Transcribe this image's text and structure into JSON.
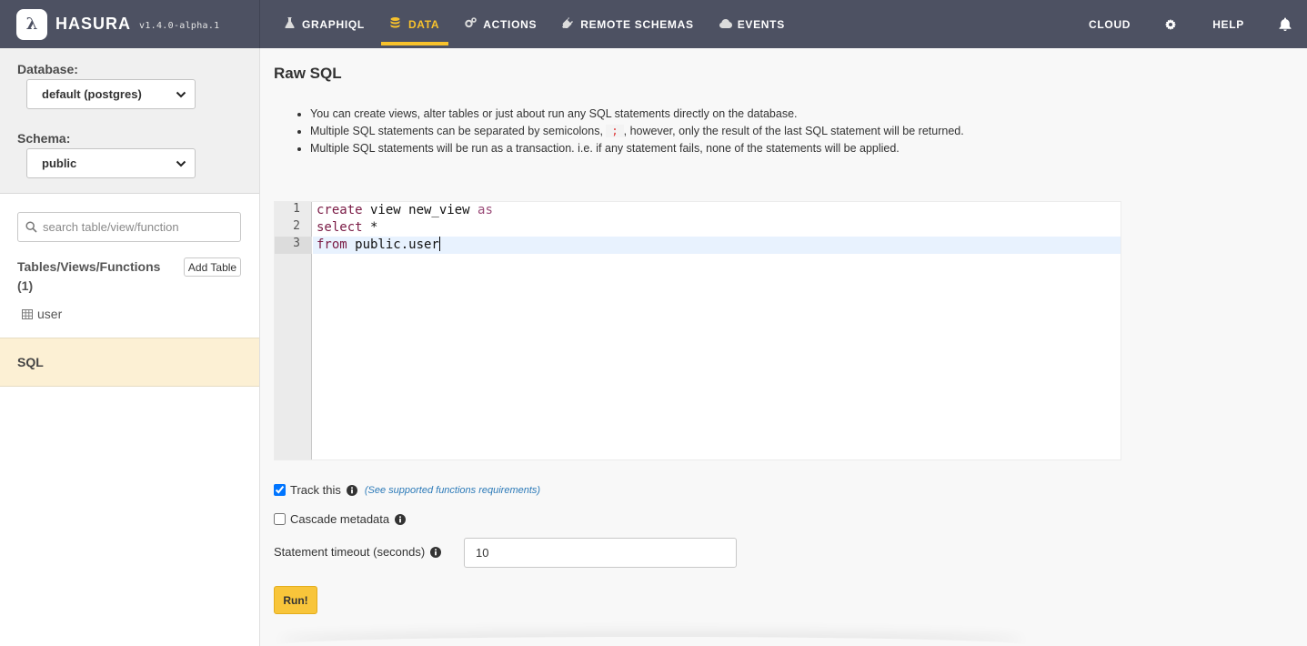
{
  "brand": {
    "logo_glyph": "λ",
    "name": "HASURA",
    "version": "v1.4.0-alpha.1"
  },
  "nav": {
    "links": [
      {
        "label": "GRAPHIQL",
        "icon": "flask-icon"
      },
      {
        "label": "DATA",
        "icon": "database-icon"
      },
      {
        "label": "ACTIONS",
        "icon": "cogs-icon"
      },
      {
        "label": "REMOTE SCHEMAS",
        "icon": "plug-icon"
      },
      {
        "label": "EVENTS",
        "icon": "cloud-icon"
      }
    ],
    "active": "DATA",
    "cloud_label": "CLOUD",
    "help_label": "HELP",
    "accent_color": "#f8c22c"
  },
  "sidebar": {
    "database_label": "Database:",
    "database_value": "default (postgres)",
    "schema_label": "Schema:",
    "schema_value": "public",
    "search_placeholder": "search table/view/function",
    "tables_heading": "Tables/Views/Functions (1)",
    "add_table_label": "Add Table",
    "tables": [
      "user"
    ],
    "sql_label": "SQL"
  },
  "main": {
    "title": "Raw SQL",
    "notes": {
      "n1": "You can create views, alter tables or just about run any SQL statements directly on the database.",
      "n2_before": "Multiple SQL statements can be separated by semicolons,",
      "n2_code": ";",
      "n2_after": ", however, only the result of the last SQL statement will be returned.",
      "n3": "Multiple SQL statements will be run as a transaction. i.e. if any statement fails, none of the statements will be applied."
    },
    "editor": {
      "line_numbers": [
        "1",
        "2",
        "3"
      ],
      "lines": [
        {
          "kw": "create",
          "rest": " view new_view ",
          "kw2": "as"
        },
        {
          "kw": "select",
          "rest": " *",
          "kw2": ""
        },
        {
          "kw": "from",
          "rest": " public.user",
          "kw2": ""
        }
      ]
    },
    "track_label": "Track this",
    "track_checked": true,
    "track_link": "(See supported functions requirements)",
    "cascade_label": "Cascade metadata",
    "cascade_checked": false,
    "timeout_label": "Statement timeout (seconds)",
    "timeout_value": "10",
    "run_label": "Run!",
    "run_color": "#f8c53a"
  }
}
